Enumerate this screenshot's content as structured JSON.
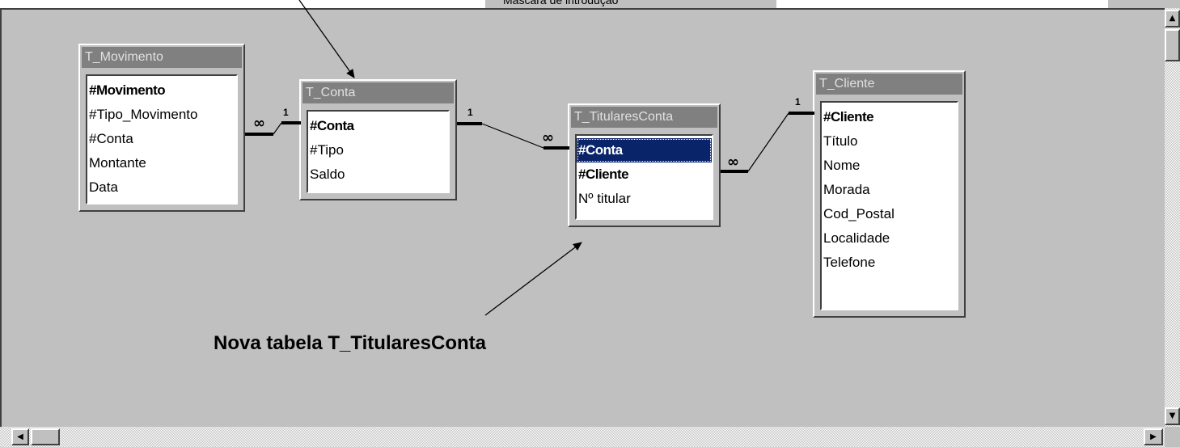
{
  "top_tab": {
    "label": "Máscara de introdução"
  },
  "tables": {
    "movimento": {
      "title": "T_Movimento",
      "fields": [
        "#Movimento",
        "#Tipo_Movimento",
        "#Conta",
        "Montante",
        "Data"
      ]
    },
    "conta": {
      "title": "T_Conta",
      "fields": [
        "#Conta",
        "#Tipo",
        "Saldo"
      ]
    },
    "titulares": {
      "title": "T_TitularesConta",
      "fields": [
        "#Conta",
        "#Cliente",
        "Nº titular"
      ]
    },
    "cliente": {
      "title": "T_Cliente",
      "fields": [
        "#Cliente",
        "Título",
        "Nome",
        "Morada",
        "Cod_Postal",
        "Localidade",
        "Telefone"
      ]
    }
  },
  "relationships": {
    "one": "1",
    "many": "∞"
  },
  "annotation": {
    "text": "Nova tabela T_TitularesConta"
  },
  "icons": {
    "scroll_up": "arrow-up-icon",
    "scroll_down": "arrow-down-icon",
    "scroll_left": "arrow-left-icon",
    "scroll_right": "arrow-right-icon"
  },
  "colors": {
    "canvas": "#c0c0c0",
    "title_bar": "#808080",
    "selection": "#0a246a"
  }
}
